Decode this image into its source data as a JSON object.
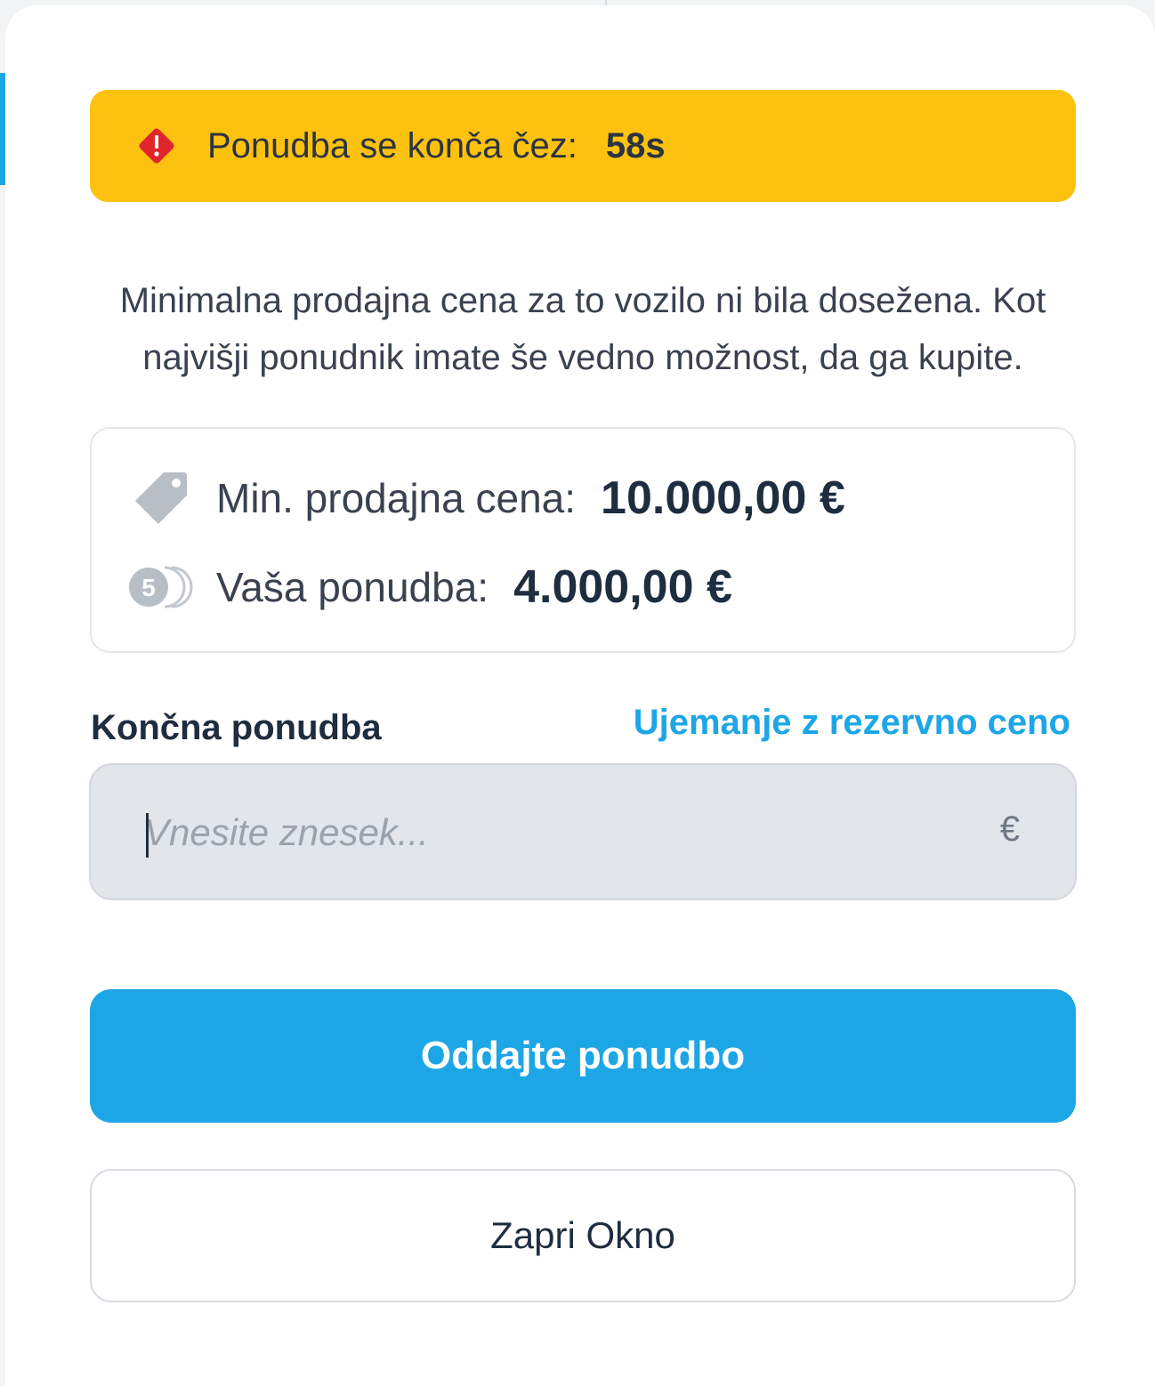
{
  "alert": {
    "label": "Ponudba se konča čez:",
    "time": "58s",
    "icon": "warning-diamond-icon"
  },
  "description": "Minimalna prodajna cena za to vozilo ni bila dosežena. Kot najvišji ponudnik imate še vedno možnost, da ga kupite.",
  "prices": {
    "min_label": "Min. prodajna cena:",
    "min_value": "10.000,00 €",
    "min_icon": "price-tag-icon",
    "bid_label": "Vaša ponudba:",
    "bid_value": "4.000,00 €",
    "bid_icon": "coins-icon"
  },
  "final_bid": {
    "label": "Končna ponudba",
    "link": "Ujemanje z rezervno ceno",
    "placeholder": "Vnesite znesek...",
    "value": "",
    "currency": "€"
  },
  "buttons": {
    "submit": "Oddajte ponudbo",
    "close": "Zapri Okno"
  },
  "colors": {
    "alert_bg": "#fdc20f",
    "alert_icon": "#e0262c",
    "primary": "#1da6e6",
    "text_dark": "#1e2d3f",
    "icon_gray": "#b7bec6"
  }
}
